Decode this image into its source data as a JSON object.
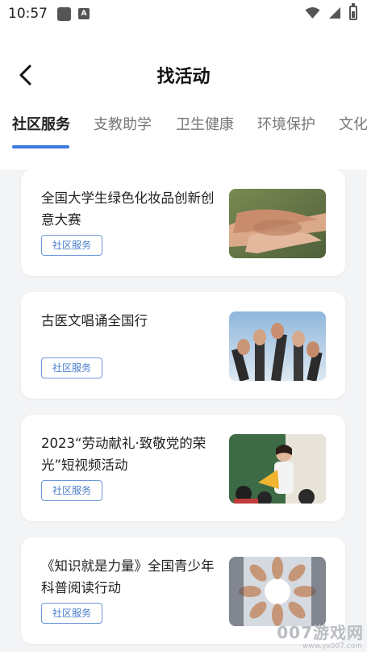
{
  "status_bar": {
    "time": "10:57",
    "icons": [
      "notification-square-icon",
      "a-icon",
      "wifi-icon",
      "signal-icon",
      "battery-icon"
    ]
  },
  "header": {
    "title": "找活动",
    "back_icon": "chevron-left-icon"
  },
  "tabs": [
    {
      "label": "社区服务",
      "active": true
    },
    {
      "label": "支教助学",
      "active": false
    },
    {
      "label": "卫生健康",
      "active": false
    },
    {
      "label": "环境保护",
      "active": false
    },
    {
      "label": "文化",
      "active": false
    }
  ],
  "activities": [
    {
      "title": "全国大学生绿色化妆品创新创意大赛",
      "tag": "社区服务",
      "image": "stacked-hands-photo"
    },
    {
      "title": "古医文唱诵全国行",
      "tag": "社区服务",
      "image": "raised-thumbs-photo"
    },
    {
      "title": "2023“劳动献礼·致敬党的荣光”短视频活动",
      "tag": "社区服务",
      "image": "teacher-classroom-photo"
    },
    {
      "title": "《知识就是力量》全国青少年科普阅读行动",
      "tag": "社区服务",
      "image": "circle-of-hands-photo"
    }
  ],
  "watermark": {
    "text": "007游戏网",
    "url": "www.yx007.com"
  },
  "colors": {
    "accent": "#3b7ae0",
    "tag_border": "#6d98d8",
    "page_bg": "#f3f4f6"
  }
}
